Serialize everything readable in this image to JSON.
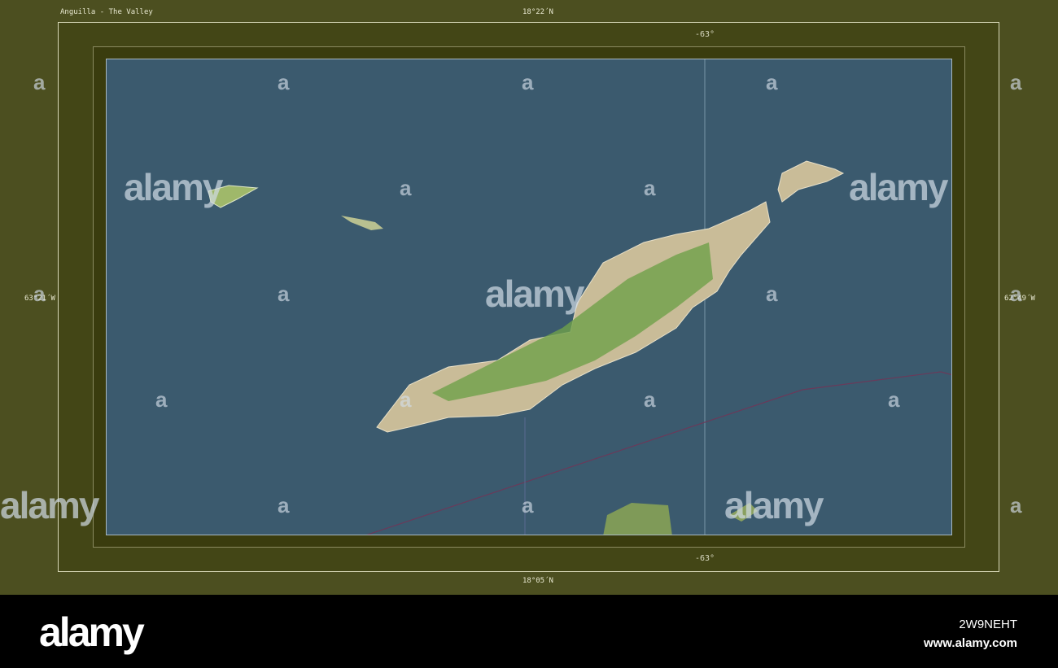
{
  "map": {
    "title": "Anguilla - The Valley",
    "lat_top": "18°22´N",
    "lat_bottom": "18°05´N",
    "lon_left": "63°21´W",
    "lon_right": "62°49´W",
    "meridian_top": "-63°",
    "meridian_bottom": "-63°"
  },
  "watermark": {
    "word": "alamy",
    "letter": "a"
  },
  "footer": {
    "logo": "alamy",
    "image_id": "2W9NEHT",
    "url": "www.alamy.com"
  }
}
